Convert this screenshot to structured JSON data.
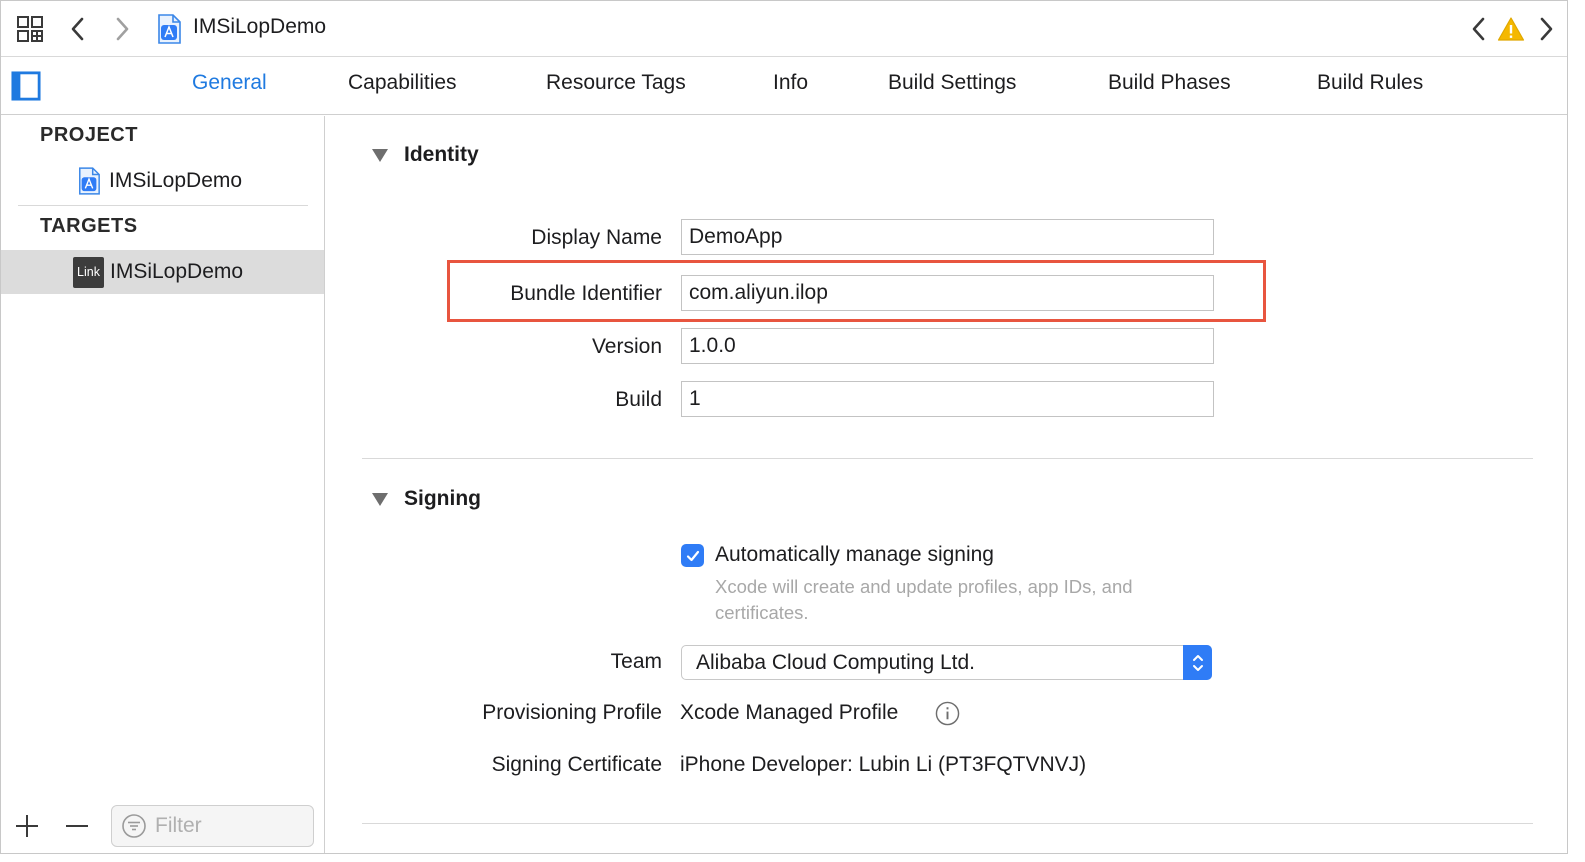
{
  "titlebar": {
    "project_name": "IMSiLopDemo",
    "icons": [
      "grid-icon",
      "back-chevron-icon",
      "forward-chevron-icon",
      "project-file-icon",
      "issue-prev-icon",
      "warning-icon",
      "issue-next-icon"
    ]
  },
  "tabs": [
    {
      "label": "General",
      "active": true
    },
    {
      "label": "Capabilities",
      "active": false
    },
    {
      "label": "Resource Tags",
      "active": false
    },
    {
      "label": "Info",
      "active": false
    },
    {
      "label": "Build Settings",
      "active": false
    },
    {
      "label": "Build Phases",
      "active": false
    },
    {
      "label": "Build Rules",
      "active": false
    }
  ],
  "sidebar": {
    "project_header": "PROJECT",
    "project_item": "IMSiLopDemo",
    "targets_header": "TARGETS",
    "target_item": "IMSiLopDemo",
    "target_icon_text": "Link",
    "filter_placeholder": "Filter"
  },
  "identity": {
    "title": "Identity",
    "display_name_label": "Display Name",
    "display_name_value": "DemoApp",
    "bundle_id_label": "Bundle Identifier",
    "bundle_id_value": "com.aliyun.ilop",
    "version_label": "Version",
    "version_value": "1.0.0",
    "build_label": "Build",
    "build_value": "1"
  },
  "signing": {
    "title": "Signing",
    "auto_manage_label": "Automatically manage signing",
    "auto_manage_checked": true,
    "auto_manage_help": "Xcode will create and update profiles, app IDs, and certificates.",
    "team_label": "Team",
    "team_value": "Alibaba Cloud Computing Ltd.",
    "profile_label": "Provisioning Profile",
    "profile_value": "Xcode Managed Profile",
    "certificate_label": "Signing Certificate",
    "certificate_value": "iPhone Developer: Lubin Li (PT3FQTVNVJ)"
  },
  "colors": {
    "accent": "#1f7ae0",
    "checkbox": "#2f7cf6",
    "highlight": "#e8553f",
    "warning": "#f5b800"
  }
}
